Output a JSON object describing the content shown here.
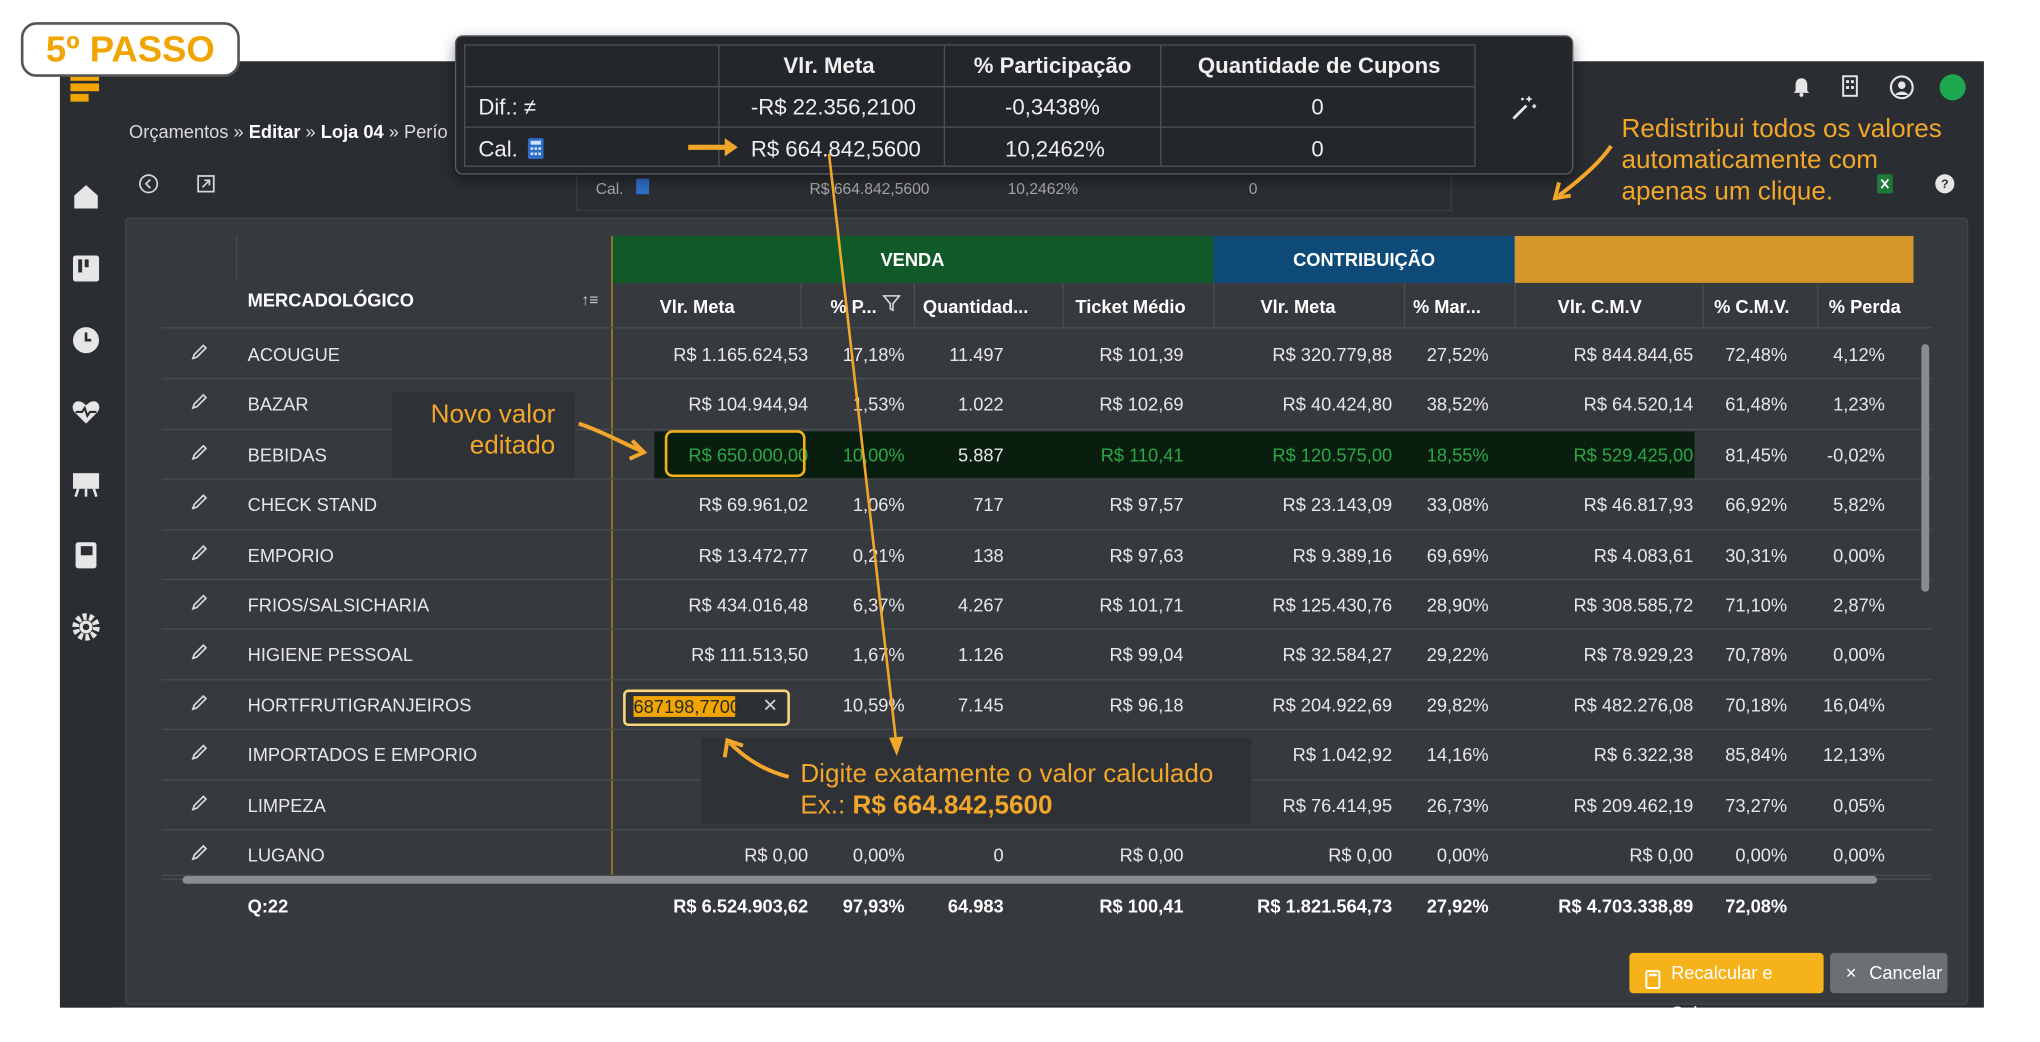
{
  "tutorial": {
    "step_label": "5º PASSO",
    "note_redistribute": [
      "Redistribui todos os valores",
      "automaticamente com",
      "apenas um clique."
    ],
    "note_new_value": [
      "Novo valor",
      "editado"
    ],
    "note_type_value": "Digite exatamente o valor calculado",
    "note_example_prefix": "Ex.: ",
    "note_example_value": "R$ 664.842,5600"
  },
  "breadcrumb": {
    "root": "Orçamentos",
    "edit": "Editar",
    "store": "Loja 04",
    "period": "Perío"
  },
  "popup": {
    "headers": [
      "Vlr. Meta",
      "% Participação",
      "Quantidade de Cupons"
    ],
    "rows": [
      {
        "label": "Dif.: ≠",
        "meta": "-R$ 22.356,2100",
        "part": "-0,3438%",
        "cupons": "0"
      },
      {
        "label": "Cal.",
        "meta": "R$ 664.842,5600",
        "part": "10,2462%",
        "cupons": "0"
      }
    ]
  },
  "bg_summary": {
    "label": "Cal.",
    "meta": "R$ 664.842,5600",
    "part": "10,2462%",
    "cupons": "0"
  },
  "groups": {
    "venda": "VENDA",
    "contrib": "CONTRIBUIÇÃO",
    "cmv": ""
  },
  "columns": [
    "MERCADOLÓGICO",
    "Vlr. Meta",
    "% P...",
    "Quantidad...",
    "Ticket Médio",
    "Vlr. Meta",
    "% Mar...",
    "Vlr. C.M.V",
    "% C.M.V.",
    "% Perda"
  ],
  "rows": [
    {
      "name": "ACOUGUE",
      "meta": "R$ 1.165.624,53",
      "part": "17,18%",
      "qtd": "11.497",
      "ticket": "R$ 101,39",
      "cmeta": "R$ 320.779,88",
      "marg": "27,52%",
      "cmv": "R$ 844.844,65",
      "pcmv": "72,48%",
      "perda": "4,12%"
    },
    {
      "name": "BAZAR",
      "meta": "R$ 104.944,94",
      "part": "1,53%",
      "qtd": "1.022",
      "ticket": "R$ 102,69",
      "cmeta": "R$ 40.424,80",
      "marg": "38,52%",
      "cmv": "R$ 64.520,14",
      "pcmv": "61,48%",
      "perda": "1,23%"
    },
    {
      "name": "BEBIDAS",
      "meta": "R$ 650.000,00",
      "part": "10,00%",
      "qtd": "5.887",
      "ticket": "R$ 110,41",
      "cmeta": "R$ 120.575,00",
      "marg": "18,55%",
      "cmv": "R$ 529.425,00",
      "pcmv": "81,45%",
      "perda": "-0,02%"
    },
    {
      "name": "CHECK STAND",
      "meta": "R$ 69.961,02",
      "part": "1,06%",
      "qtd": "717",
      "ticket": "R$ 97,57",
      "cmeta": "R$ 23.143,09",
      "marg": "33,08%",
      "cmv": "R$ 46.817,93",
      "pcmv": "66,92%",
      "perda": "5,82%"
    },
    {
      "name": "EMPORIO",
      "meta": "R$ 13.472,77",
      "part": "0,21%",
      "qtd": "138",
      "ticket": "R$ 97,63",
      "cmeta": "R$ 9.389,16",
      "marg": "69,69%",
      "cmv": "R$ 4.083,61",
      "pcmv": "30,31%",
      "perda": "0,00%"
    },
    {
      "name": "FRIOS/SALSICHARIA",
      "meta": "R$ 434.016,48",
      "part": "6,37%",
      "qtd": "4.267",
      "ticket": "R$ 101,71",
      "cmeta": "R$ 125.430,76",
      "marg": "28,90%",
      "cmv": "R$ 308.585,72",
      "pcmv": "71,10%",
      "perda": "2,87%"
    },
    {
      "name": "HIGIENE PESSOAL",
      "meta": "R$ 111.513,50",
      "part": "1,67%",
      "qtd": "1.126",
      "ticket": "R$ 99,04",
      "cmeta": "R$ 32.584,27",
      "marg": "29,22%",
      "cmv": "R$ 78.929,23",
      "pcmv": "70,78%",
      "perda": "0,00%"
    },
    {
      "name": "HORTFRUTIGRANJEIROS",
      "meta": "687198,7700",
      "part": "10,59%",
      "qtd": "7.145",
      "ticket": "R$ 96,18",
      "cmeta": "R$ 204.922,69",
      "marg": "29,82%",
      "cmv": "R$ 482.276,08",
      "pcmv": "70,18%",
      "perda": "16,04%"
    },
    {
      "name": "IMPORTADOS E EMPORIO",
      "meta": "",
      "part": "",
      "qtd": "",
      "ticket": "",
      "cmeta": "R$ 1.042,92",
      "marg": "14,16%",
      "cmv": "R$ 6.322,38",
      "pcmv": "85,84%",
      "perda": "12,13%"
    },
    {
      "name": "LIMPEZA",
      "meta": "R$",
      "part": "",
      "qtd": "",
      "ticket": "",
      "cmeta": "R$ 76.414,95",
      "marg": "26,73%",
      "cmv": "R$ 209.462,19",
      "pcmv": "73,27%",
      "perda": "0,05%"
    },
    {
      "name": "LUGANO",
      "meta": "R$ 0,00",
      "part": "0,00%",
      "qtd": "0",
      "ticket": "R$ 0,00",
      "cmeta": "R$ 0,00",
      "marg": "0,00%",
      "cmv": "R$ 0,00",
      "pcmv": "0,00%",
      "perda": "0,00%"
    }
  ],
  "totals": {
    "name": "Q:22",
    "meta": "R$ 6.524.903,62",
    "part": "97,93%",
    "qtd": "64.983",
    "ticket": "R$ 100,41",
    "cmeta": "R$ 1.821.564,73",
    "marg": "27,92%",
    "cmv": "R$ 4.703.338,89",
    "pcmv": "72,08%"
  },
  "buttons": {
    "save": "Recalcular e Salvar",
    "cancel": "Cancelar"
  },
  "colors": {
    "accent": "#f0a500",
    "venda": "#0f5a28",
    "contrib": "#0e4a78",
    "cmv": "#d6962a",
    "edited_text": "#2aa845"
  }
}
